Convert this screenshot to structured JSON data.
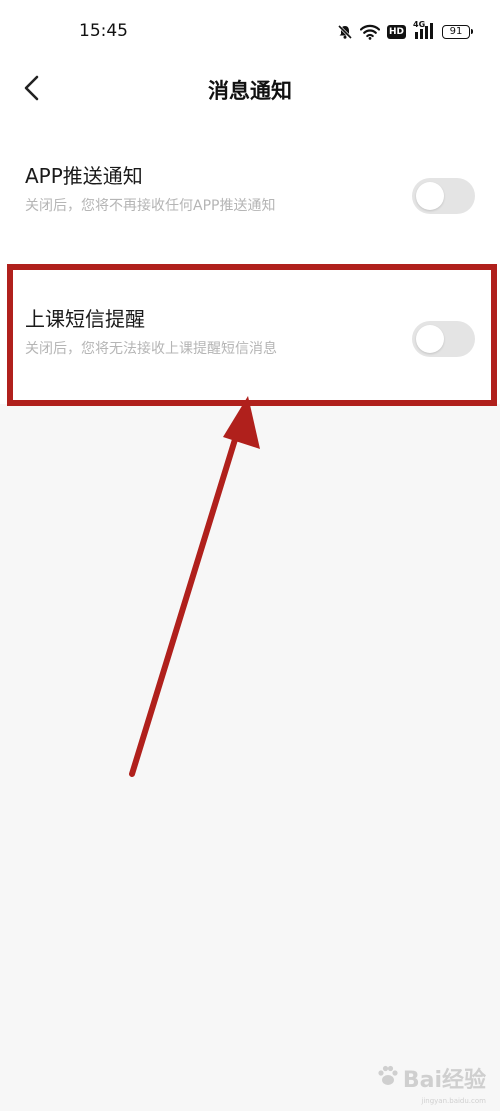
{
  "status_bar": {
    "time": "15:45",
    "hd_label": "HD",
    "network_label": "4G",
    "battery_level": "91"
  },
  "nav": {
    "title": "消息通知"
  },
  "settings": {
    "items": [
      {
        "title": "APP推送通知",
        "description": "关闭后，您将不再接收任何APP推送通知",
        "enabled": false
      },
      {
        "title": "上课短信提醒",
        "description": "关闭后，您将无法接收上课提醒短信消息",
        "enabled": false
      }
    ]
  },
  "colors": {
    "annotation": "#b0201c",
    "toggle_off": "#e4e4e4",
    "page_background": "#f7f7f7"
  },
  "watermark": {
    "brand": "Bai经验",
    "url": "jingyan.baidu.com"
  }
}
